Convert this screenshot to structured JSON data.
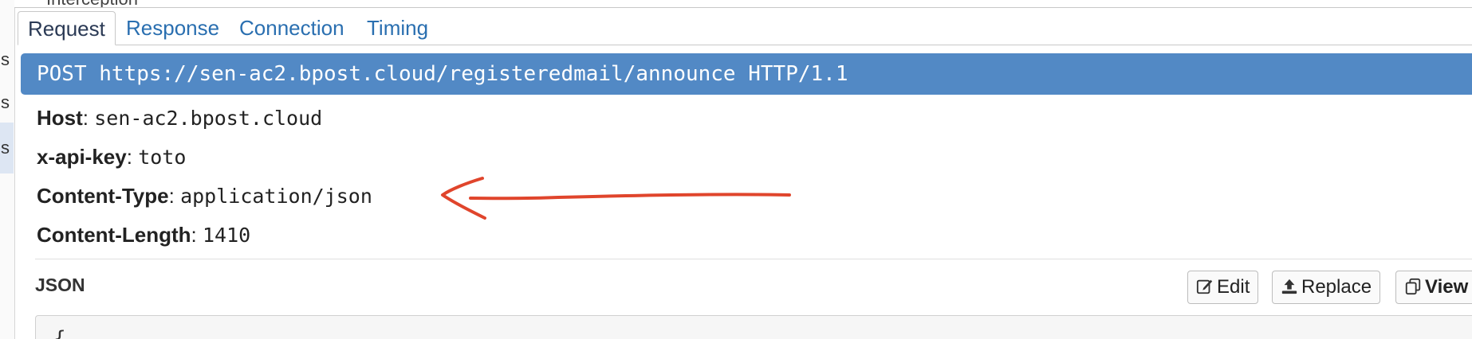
{
  "top_clip": {
    "text": "Interception"
  },
  "left_strip": {
    "items": [
      "s",
      "s",
      "s"
    ]
  },
  "tabs": [
    {
      "label": "Request",
      "active": true
    },
    {
      "label": "Response",
      "active": false
    },
    {
      "label": "Connection",
      "active": false
    },
    {
      "label": "Timing",
      "active": false
    }
  ],
  "request_line": "POST https://sen-ac2.bpost.cloud/registeredmail/announce HTTP/1.1",
  "headers": [
    {
      "key": "Host",
      "value": "sen-ac2.bpost.cloud"
    },
    {
      "key": "x-api-key",
      "value": "toto"
    },
    {
      "key": "Content-Type",
      "value": "application/json"
    },
    {
      "key": "Content-Length",
      "value": "1410"
    }
  ],
  "body": {
    "label": "JSON",
    "buttons": {
      "edit": "Edit",
      "replace": "Replace",
      "view": "View"
    },
    "preview": "{"
  },
  "colors": {
    "request_line_bg": "#5289c5",
    "tab_link": "#2a6fb0",
    "annotation_arrow": "#e0452c"
  },
  "icons": {
    "edit": "edit-icon",
    "replace": "upload-icon",
    "view": "copy-icon",
    "annotation": "arrow-left-icon"
  }
}
